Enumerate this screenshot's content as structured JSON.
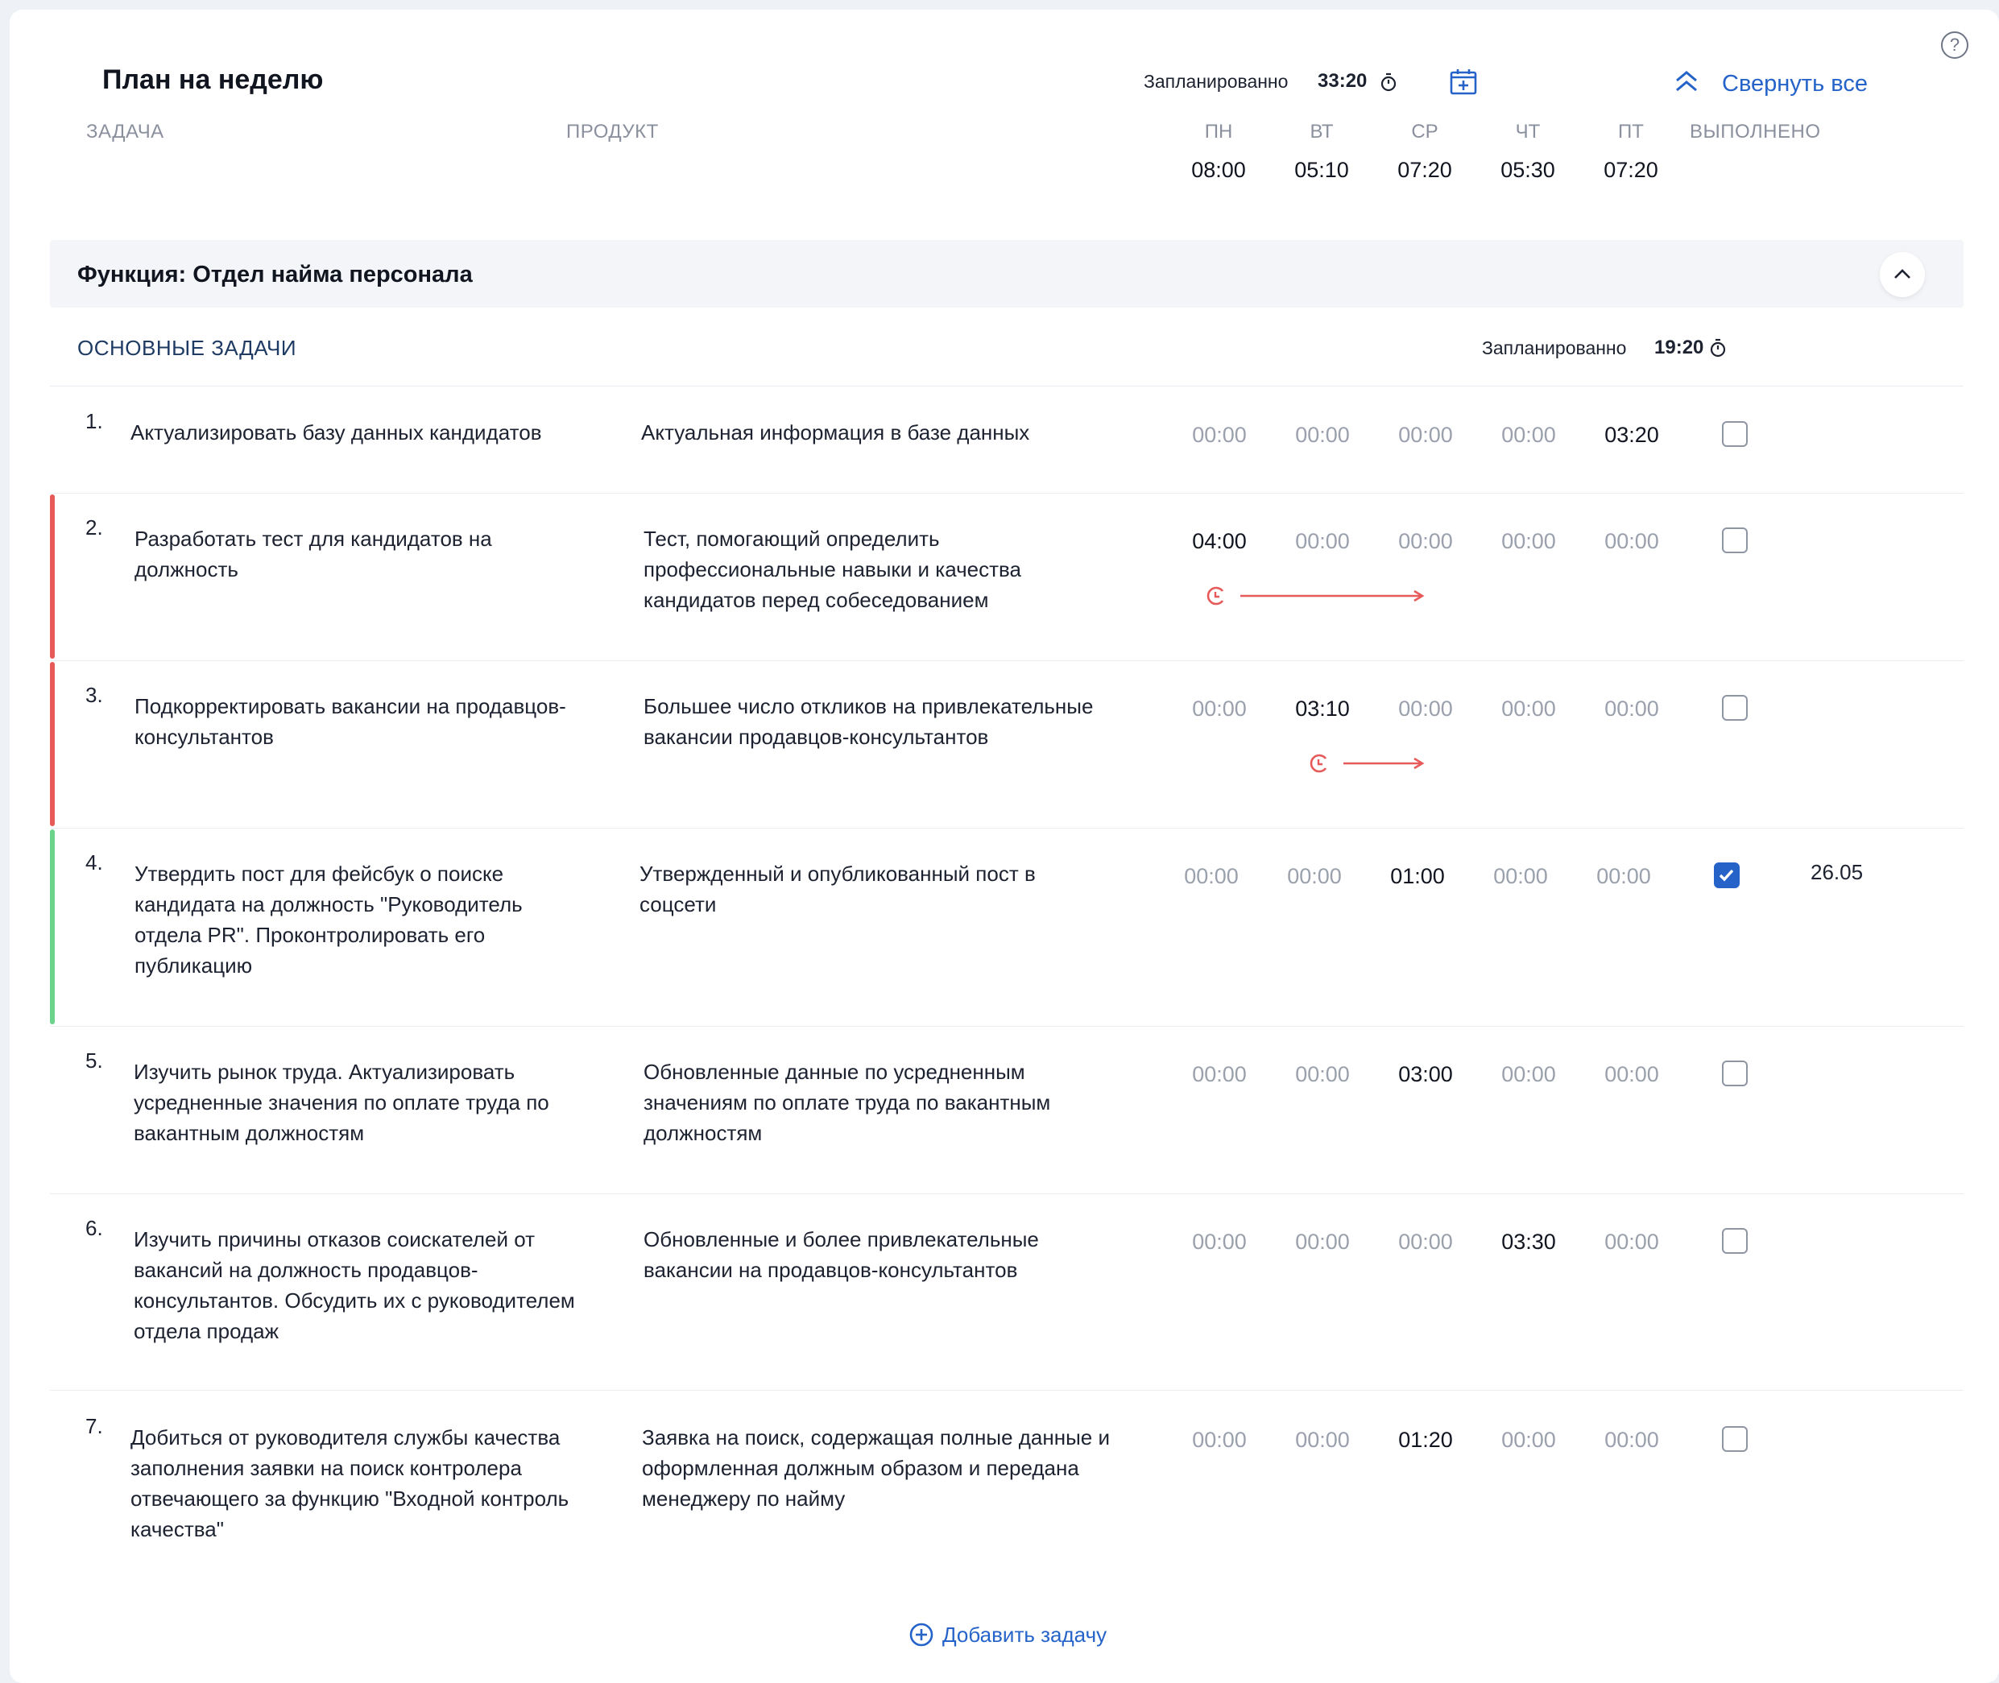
{
  "header": {
    "title": "План на неделю",
    "planned_label": "Запланированно",
    "planned_total": "33:20",
    "collapse_all": "Свернуть все",
    "help": "?"
  },
  "columns": {
    "task": "ЗАДАЧА",
    "product": "ПРОДУКТ",
    "done": "ВЫПОЛНЕНО",
    "days": [
      "ПН",
      "ВТ",
      "СР",
      "ЧТ",
      "ПТ"
    ],
    "day_totals": [
      "08:00",
      "05:10",
      "07:20",
      "05:30",
      "07:20"
    ]
  },
  "function_block": {
    "title": "Функция: Отдел найма персонала",
    "section_title": "ОСНОВНЫЕ ЗАДАЧИ",
    "section_planned_label": "Запланированно",
    "section_planned_total": "19:20"
  },
  "tasks": [
    {
      "num": "1.",
      "task": "Актуализировать базу данных кандидатов",
      "product": "Актуальная информация в базе данных",
      "times": [
        "00:00",
        "00:00",
        "00:00",
        "00:00",
        "03:20"
      ],
      "done": false,
      "done_date": "",
      "stripe": "none"
    },
    {
      "num": "2.",
      "task": "Разработать тест для кандидатов на должность",
      "product": "Тест, помогающий определить профессиональные навыки и качества кандидатов перед собеседованием",
      "times": [
        "04:00",
        "00:00",
        "00:00",
        "00:00",
        "00:00"
      ],
      "done": false,
      "done_date": "",
      "stripe": "red"
    },
    {
      "num": "3.",
      "task": "Подкорректировать вакансии на продавцов-консультантов",
      "product": "Большее число откликов на привлекательные вакансии продавцов-консультантов",
      "times": [
        "00:00",
        "03:10",
        "00:00",
        "00:00",
        "00:00"
      ],
      "done": false,
      "done_date": "",
      "stripe": "red"
    },
    {
      "num": "4.",
      "task": "Утвердить пост для фейсбук о поиске кандидата на должность \"Руководитель отдела PR\". Проконтролировать его публикацию",
      "product": "Утвержденный и опубликованный пост в соцсети",
      "times": [
        "00:00",
        "00:00",
        "01:00",
        "00:00",
        "00:00"
      ],
      "done": true,
      "done_date": "26.05",
      "stripe": "green"
    },
    {
      "num": "5.",
      "task": "Изучить рынок труда. Актуализировать усредненные значения по оплате труда по вакантным должностям",
      "product": "Обновленные данные по усредненным значениям по оплате труда по вакантным должностям",
      "times": [
        "00:00",
        "00:00",
        "03:00",
        "00:00",
        "00:00"
      ],
      "done": false,
      "done_date": "",
      "stripe": "none"
    },
    {
      "num": "6.",
      "task": "Изучить причины отказов соискателей от вакансий на должность продавцов-консультантов. Обсудить их с руководителем отдела продаж",
      "product": "Обновленные и более привлекательные вакансии на продавцов-консультантов",
      "times": [
        "00:00",
        "00:00",
        "00:00",
        "03:30",
        "00:00"
      ],
      "done": false,
      "done_date": "",
      "stripe": "none"
    },
    {
      "num": "7.",
      "task": "Добиться от руководителя службы качества заполнения заявки на поиск контролера отвечающего за функцию \"Входной контроль качества\"",
      "product": "Заявка на поиск, содержащая полные данные и оформленная должным образом и передана менеджеру по найму",
      "times": [
        "00:00",
        "00:00",
        "01:20",
        "00:00",
        "00:00"
      ],
      "done": false,
      "done_date": "",
      "stripe": "none"
    }
  ],
  "add_task": "Добавить задачу",
  "colors": {
    "accent": "#2563c9",
    "overdue": "#e85a5a",
    "done": "#6bd48a"
  }
}
